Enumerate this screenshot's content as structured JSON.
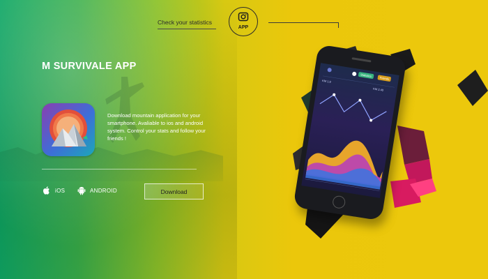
{
  "header": {
    "check_stats": "Check your statistics",
    "badge_label": "APP",
    "badge_icon": "camera-icon"
  },
  "hero": {
    "title": "M SURVIVALE APP",
    "description": "Download mountain application for your smartphone. Avaliable to ios and android system. Control your stats and follow your friends !"
  },
  "platforms": {
    "ios": {
      "label": "iOS",
      "icon": "apple-icon"
    },
    "android": {
      "label": "ANDROID",
      "icon": "android-icon"
    }
  },
  "cta": {
    "download_label": "Download"
  },
  "phone_screen": {
    "tab1": "Statistics",
    "tab2": "Friends",
    "stat_left": "KM 1.9",
    "stat_right": "KM 2.40"
  },
  "colors": {
    "gradient_left": "#0fa765",
    "gradient_right": "#ecc80c",
    "text_light": "#ffffff",
    "text_dark": "#2b2b2b"
  }
}
